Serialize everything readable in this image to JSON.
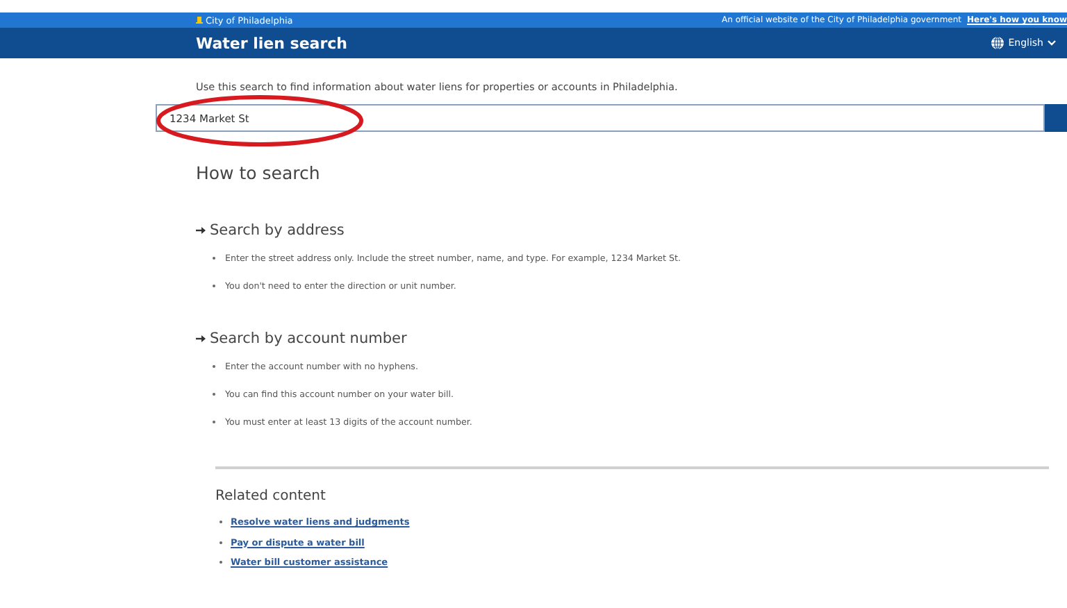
{
  "top_bar": {
    "logo_text": "City of Philadelphia",
    "official_text": "An official website of the City of Philadelphia government",
    "official_link": "Here's how you know"
  },
  "header": {
    "title": "Water lien search",
    "language": "English"
  },
  "intro": "Use this search to find information about water liens for properties or accounts in Philadelphia.",
  "search": {
    "value": "1234 Market St"
  },
  "how_to": {
    "title": "How to search",
    "sections": [
      {
        "title": "Search by address",
        "items": [
          "Enter the street address only. Include the street number, name, and type. For example, 1234 Market St.",
          "You don't need to enter the direction or unit number."
        ]
      },
      {
        "title": "Search by account number",
        "items": [
          "Enter the account number with no hyphens.",
          "You can find this account number on your water bill.",
          "You must enter at least 13 digits of the account number."
        ]
      }
    ]
  },
  "related": {
    "title": "Related content",
    "links": [
      "Resolve water liens and judgments",
      "Pay or dispute a water bill",
      "Water bill customer assistance"
    ]
  }
}
